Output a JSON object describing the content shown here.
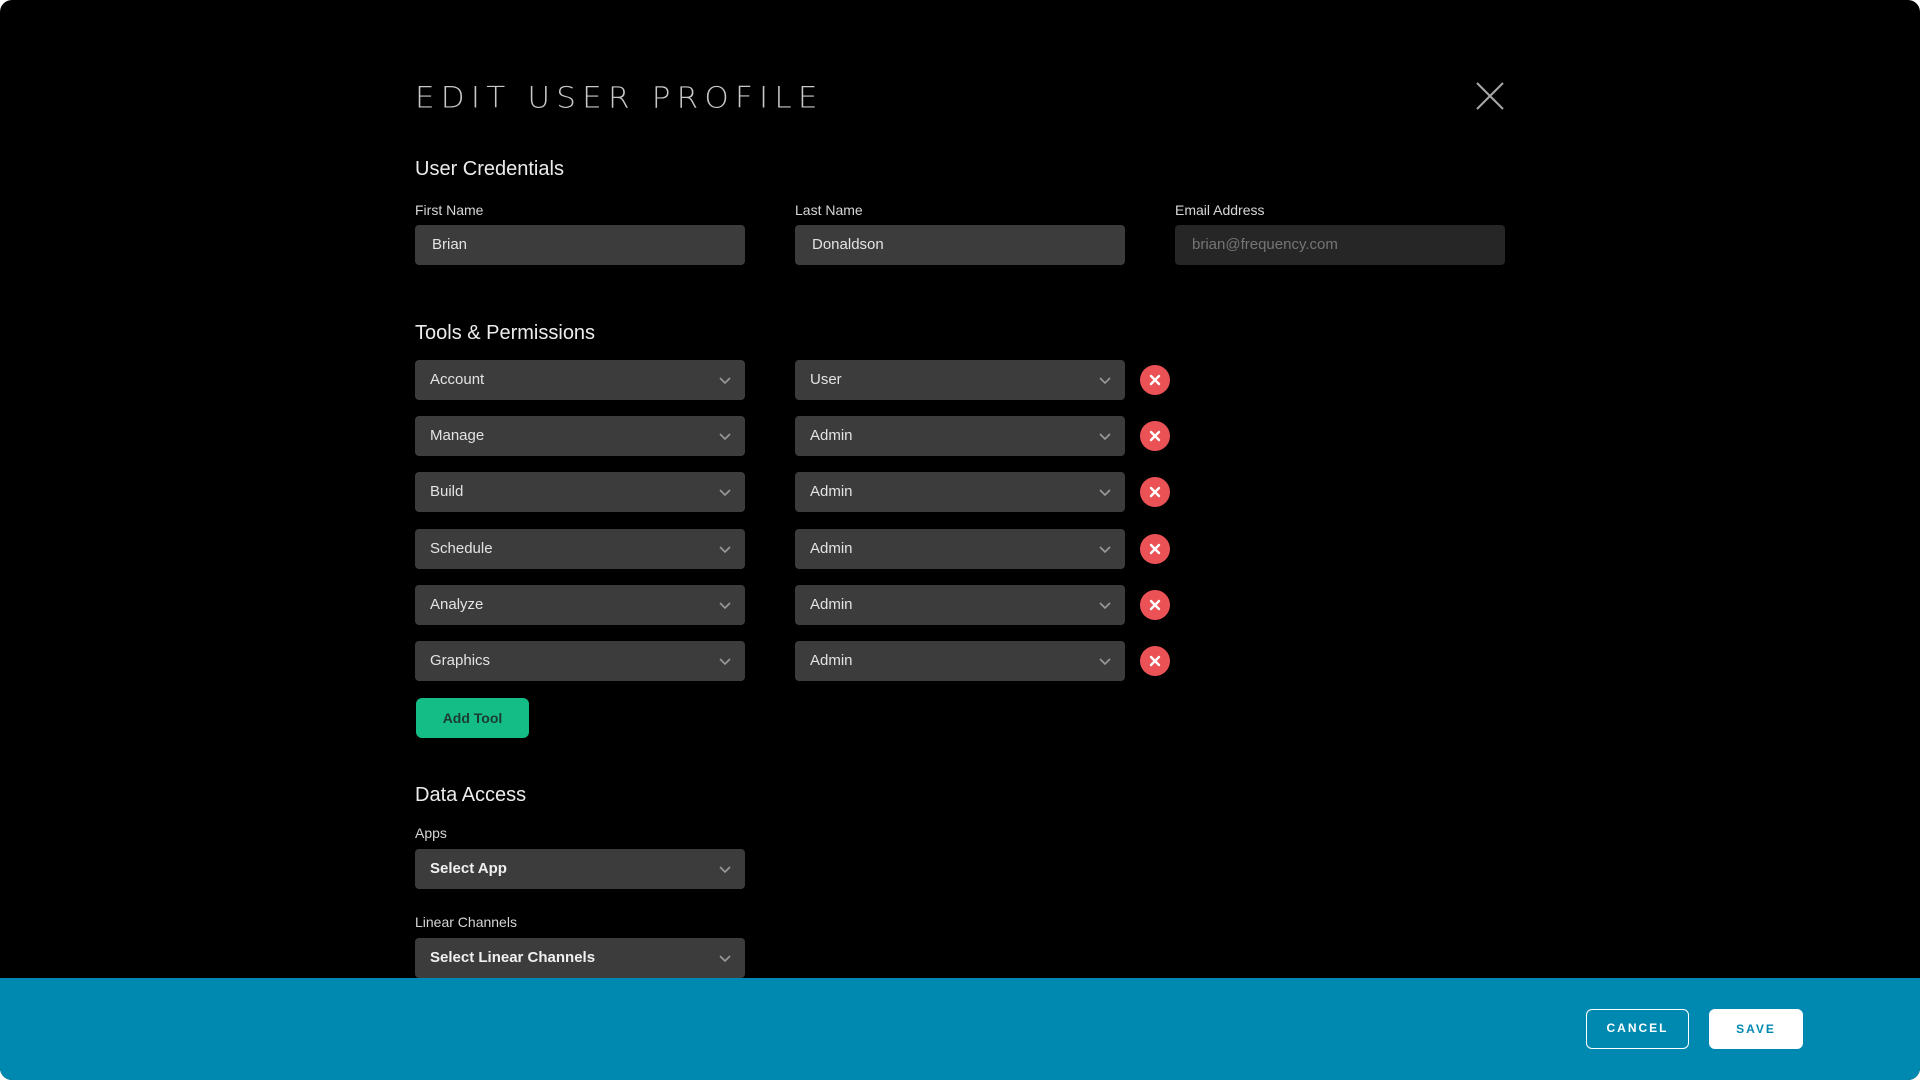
{
  "header": {
    "title": "EDIT USER PROFILE",
    "close_icon": "close-icon"
  },
  "credentials": {
    "section_title": "User Credentials",
    "first_name": {
      "label": "First Name",
      "value": "Brian"
    },
    "last_name": {
      "label": "Last Name",
      "value": "Donaldson"
    },
    "email": {
      "label": "Email Address",
      "placeholder": "brian@frequency.com",
      "value": ""
    }
  },
  "permissions": {
    "section_title": "Tools & Permissions",
    "rows": [
      {
        "tool": "Account",
        "role": "User"
      },
      {
        "tool": "Manage",
        "role": "Admin"
      },
      {
        "tool": "Build",
        "role": "Admin"
      },
      {
        "tool": "Schedule",
        "role": "Admin"
      },
      {
        "tool": "Analyze",
        "role": "Admin"
      },
      {
        "tool": "Graphics",
        "role": "Admin"
      }
    ],
    "add_tool_label": "Add Tool",
    "remove_icon": "remove-circle-x-icon"
  },
  "data_access": {
    "section_title": "Data Access",
    "apps": {
      "label": "Apps",
      "value": "Select App"
    },
    "linear_channels": {
      "label": "Linear Channels",
      "value": "Select Linear Channels"
    }
  },
  "footer": {
    "cancel_label": "CANCEL",
    "save_label": "SAVE"
  },
  "colors": {
    "background": "#000000",
    "field": "#3c3c3c",
    "field_disabled": "#262626",
    "remove": "#eb5255",
    "add_tool": "#14bc86",
    "footer": "#0089b0"
  }
}
